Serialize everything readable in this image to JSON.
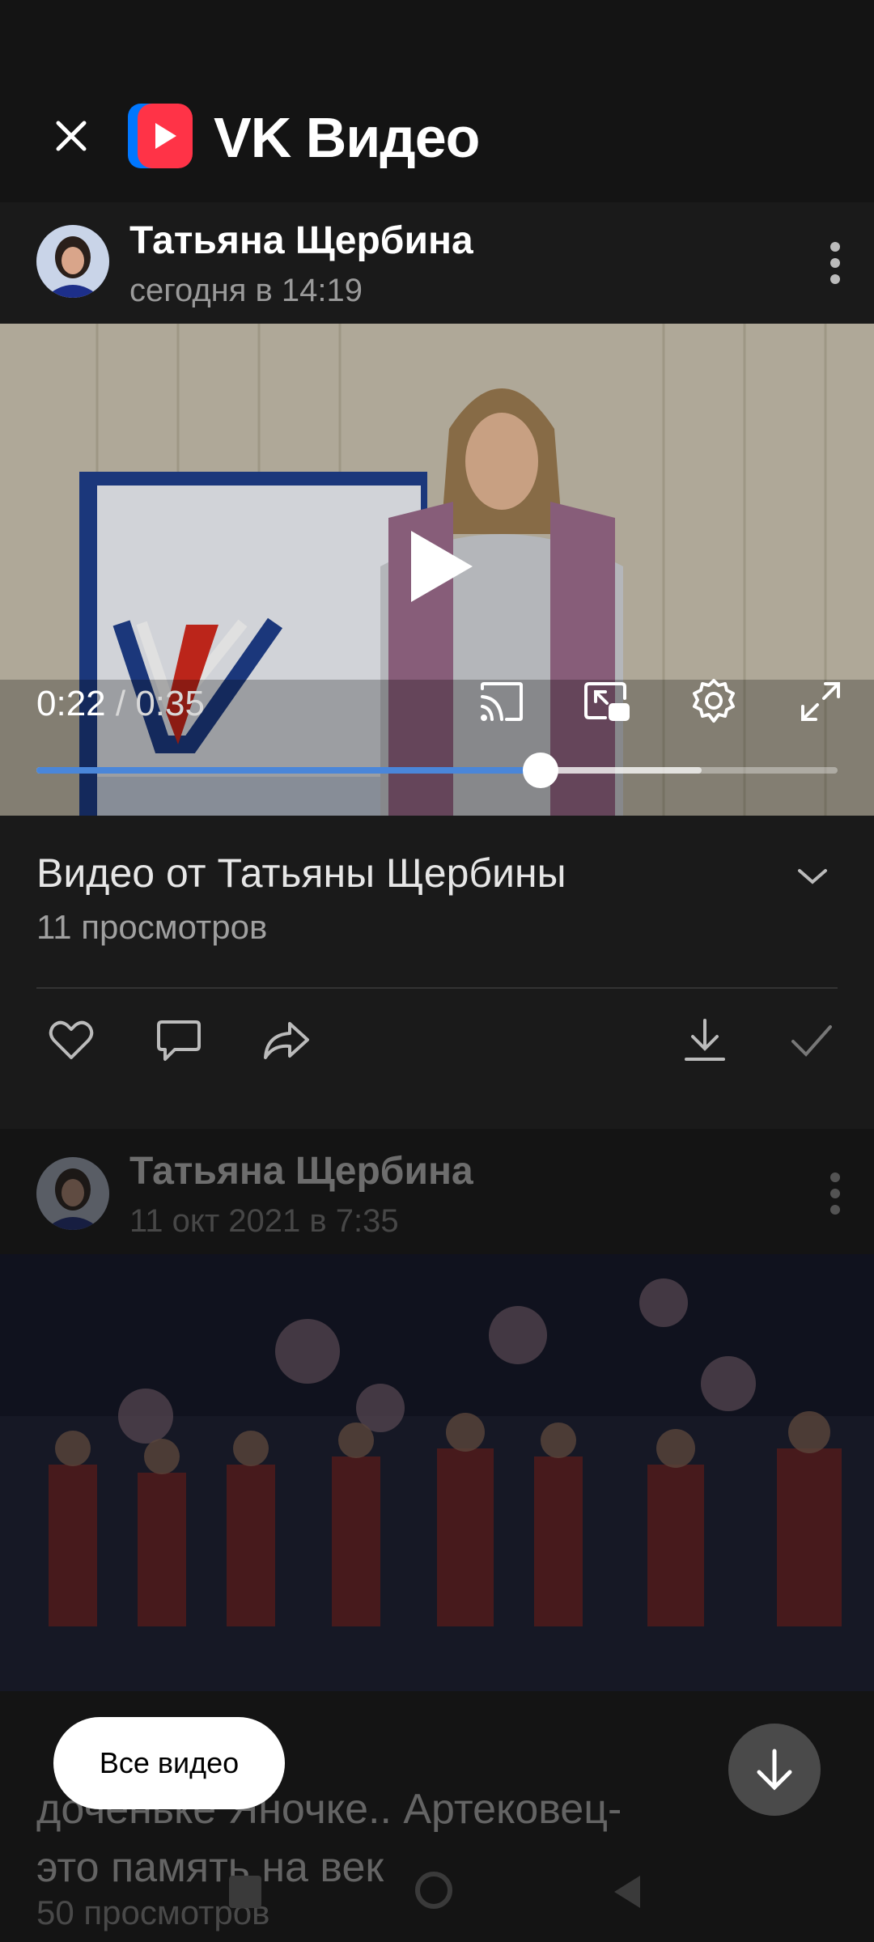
{
  "header": {
    "brand": "VK Видео"
  },
  "post": {
    "author": "Татьяна Щербина",
    "date": "сегодня в 14:19"
  },
  "player": {
    "current_time": "0:22",
    "separator": " / ",
    "duration": "0:35",
    "progress_fraction": 0.629,
    "buffered_fraction": 0.83
  },
  "video": {
    "title": "Видео от Татьяны Щербины",
    "views": "11 просмотров"
  },
  "next_post": {
    "author": "Татьяна Щербина",
    "date": "11 окт 2021 в 7:35",
    "title_line1": "доченьке Яночке.. Артековец-",
    "title_line2": "это память на век",
    "views": "50 просмотров"
  },
  "all_videos_label": "Все видео",
  "colors": {
    "accent": "#4a86d9",
    "logo_red": "#ff3347",
    "logo_blue": "#0077ff"
  }
}
